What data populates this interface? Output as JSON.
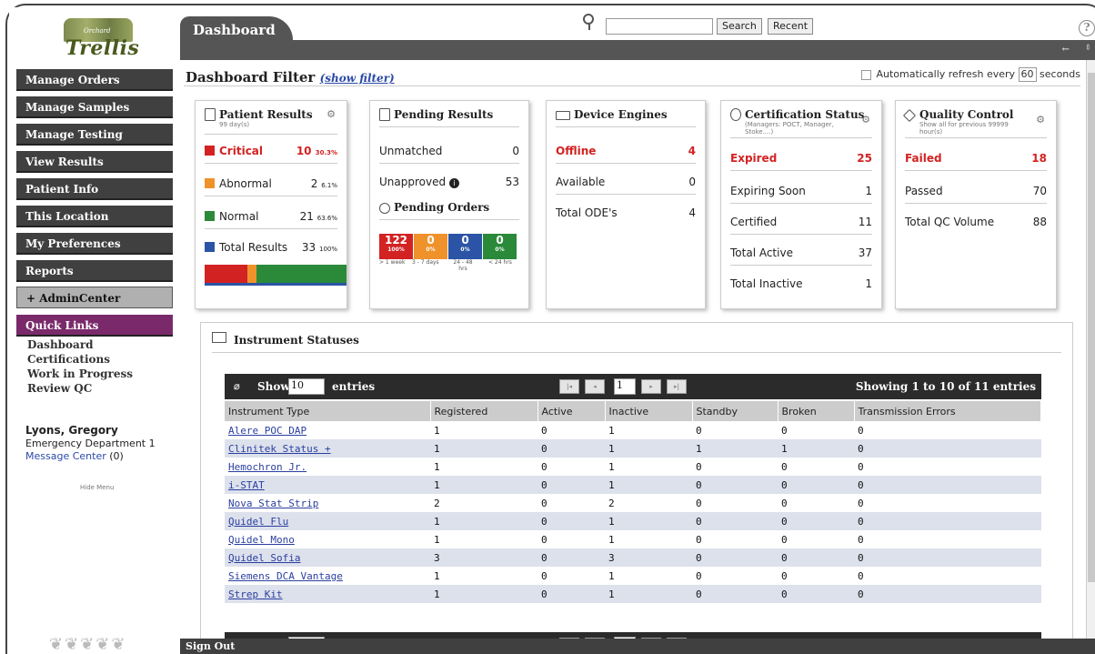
{
  "logo": {
    "top_text": "Orchard",
    "word": "Trellis"
  },
  "nav": {
    "manage_orders": "Manage Orders",
    "manage_samples": "Manage Samples",
    "manage_testing": "Manage Testing",
    "view_results": "View Results",
    "patient_info": "Patient Info",
    "this_location": "This Location",
    "my_preferences": "My Preferences",
    "reports": "Reports",
    "admin_center": "+ AdminCenter",
    "quick_links": "Quick Links"
  },
  "quick_links": [
    "Dashboard",
    "Certifications",
    "Work in Progress",
    "Review QC"
  ],
  "user": {
    "name": "Lyons, Gregory",
    "dept": "Emergency Department 1",
    "message_center": "Message Center",
    "message_count": "(0)"
  },
  "hide_menu": "Hide Menu",
  "header": {
    "tab": "Dashboard",
    "search_btn": "Search",
    "recent_btn": "Recent",
    "help": "?"
  },
  "filter": {
    "title": "Dashboard Filter",
    "show_filter": "(show filter)",
    "refresh_pre": "Automatically refresh every",
    "refresh_value": "60",
    "refresh_post": "seconds"
  },
  "patient_results": {
    "title": "Patient Results",
    "sub": "99 day(s)",
    "critical_label": "Critical",
    "critical_val": "10",
    "critical_pct": "30.3%",
    "abnormal_label": "Abnormal",
    "abnormal_val": "2",
    "abnormal_pct": "6.1%",
    "normal_label": "Normal",
    "normal_val": "21",
    "normal_pct": "63.6%",
    "total_label": "Total Results",
    "total_val": "33",
    "total_pct": "100%"
  },
  "pending_results": {
    "title": "Pending Results",
    "unmatched_label": "Unmatched",
    "unmatched_val": "0",
    "unapproved_label": "Unapproved",
    "unapproved_val": "53",
    "orders_title": "Pending Orders",
    "boxes": [
      {
        "val": "122",
        "pct": "100%",
        "color": "#d32222",
        "label": "> 1 week"
      },
      {
        "val": "0",
        "pct": "0%",
        "color": "#f0922b",
        "label": "3 - 7 days"
      },
      {
        "val": "0",
        "pct": "0%",
        "color": "#2b54a6",
        "label": "24 - 48 hrs"
      },
      {
        "val": "0",
        "pct": "0%",
        "color": "#2a8a3a",
        "label": "< 24 hrs"
      }
    ]
  },
  "device_engines": {
    "title": "Device Engines",
    "offline_label": "Offline",
    "offline_val": "4",
    "available_label": "Available",
    "available_val": "0",
    "total_label": "Total ODE's",
    "total_val": "4"
  },
  "certification": {
    "title": "Certification Status",
    "sub": "(Managers: POCT, Manager, Stoke....)",
    "expired_label": "Expired",
    "expired_val": "25",
    "expiring_label": "Expiring Soon",
    "expiring_val": "1",
    "certified_label": "Certified",
    "certified_val": "11",
    "active_label": "Total Active",
    "active_val": "37",
    "inactive_label": "Total Inactive",
    "inactive_val": "1"
  },
  "qc": {
    "title": "Quality Control",
    "sub": "Show all for previous 99999 hour(s)",
    "failed_label": "Failed",
    "failed_val": "18",
    "passed_label": "Passed",
    "passed_val": "70",
    "volume_label": "Total QC Volume",
    "volume_val": "88"
  },
  "instruments": {
    "title": "Instrument Statuses",
    "show": "Show",
    "entries_value": "10",
    "entries": "entries",
    "page": "1",
    "info": "Showing 1 to 10 of 11 entries",
    "columns": [
      "Instrument Type",
      "Registered",
      "Active",
      "Inactive",
      "Standby",
      "Broken",
      "Transmission Errors"
    ],
    "rows": [
      [
        "Alere POC DAP",
        "1",
        "0",
        "1",
        "0",
        "0",
        "0"
      ],
      [
        "Clinitek Status +",
        "1",
        "0",
        "1",
        "1",
        "1",
        "0"
      ],
      [
        "Hemochron Jr.",
        "1",
        "0",
        "1",
        "0",
        "0",
        "0"
      ],
      [
        "i-STAT",
        "1",
        "0",
        "1",
        "0",
        "0",
        "0"
      ],
      [
        "Nova Stat Strip",
        "2",
        "0",
        "2",
        "0",
        "0",
        "0"
      ],
      [
        "Quidel Flu",
        "1",
        "0",
        "1",
        "0",
        "0",
        "0"
      ],
      [
        "Quidel Mono",
        "1",
        "0",
        "1",
        "0",
        "0",
        "0"
      ],
      [
        "Quidel Sofia",
        "3",
        "0",
        "3",
        "0",
        "0",
        "0"
      ],
      [
        "Siemens DCA Vantage",
        "1",
        "0",
        "1",
        "0",
        "0",
        "0"
      ],
      [
        "Strep Kit",
        "1",
        "0",
        "1",
        "0",
        "0",
        "0"
      ]
    ]
  },
  "signout": "Sign Out",
  "colors": {
    "critical": "#d32222",
    "abnormal": "#f0922b",
    "normal": "#2a8a3a",
    "total": "#2b54a6",
    "nav": "#404040",
    "quick": "#7a2a6a"
  }
}
